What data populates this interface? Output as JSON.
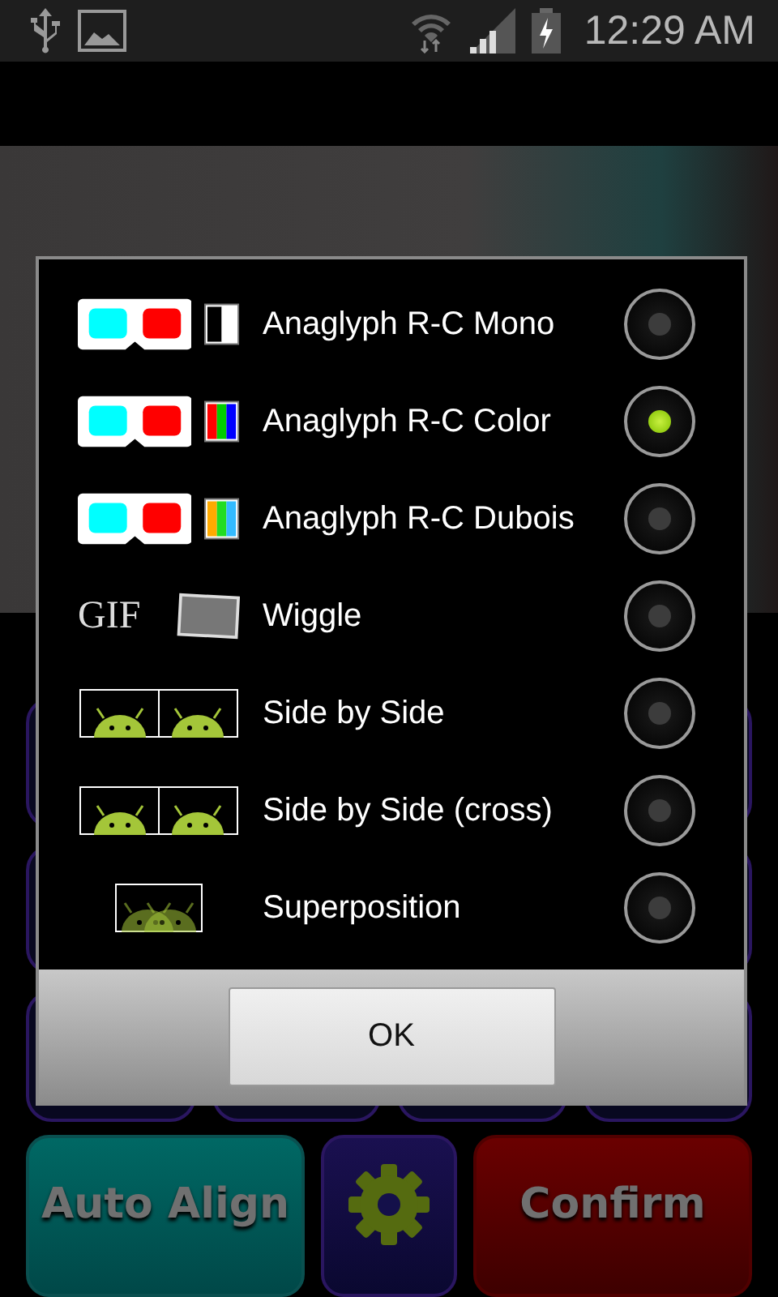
{
  "status_bar": {
    "time": "12:29 AM"
  },
  "dialog": {
    "options": [
      {
        "label": "Anaglyph R-C Mono",
        "kind": "anaglyph_mono",
        "selected": false
      },
      {
        "label": "Anaglyph R-C Color",
        "kind": "anaglyph_color",
        "selected": true
      },
      {
        "label": "Anaglyph R-C Dubois",
        "kind": "anaglyph_dubois",
        "selected": false
      },
      {
        "label": "Wiggle",
        "kind": "gif",
        "icon_text": "GIF",
        "selected": false
      },
      {
        "label": "Side by Side",
        "kind": "side_by_side",
        "selected": false
      },
      {
        "label": "Side by Side (cross)",
        "kind": "side_by_side_cross",
        "selected": false
      },
      {
        "label": "Superposition",
        "kind": "superposition",
        "selected": false
      }
    ],
    "ok_button": "OK"
  },
  "bottom_buttons": [
    {
      "label": "Auto Align",
      "kind": "auto_align"
    },
    {
      "kind": "settings"
    },
    {
      "label": "Confirm",
      "kind": "confirm"
    }
  ]
}
